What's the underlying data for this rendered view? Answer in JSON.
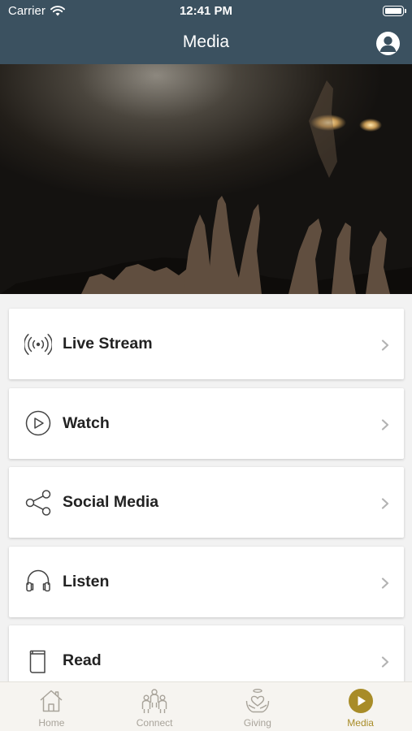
{
  "status_bar": {
    "carrier": "Carrier",
    "time": "12:41 PM"
  },
  "nav": {
    "title": "Media"
  },
  "menu": {
    "items": [
      {
        "label": "Live Stream",
        "icon": "broadcast-icon"
      },
      {
        "label": "Watch",
        "icon": "play-circle-icon"
      },
      {
        "label": "Social Media",
        "icon": "share-icon"
      },
      {
        "label": "Listen",
        "icon": "headphones-icon"
      },
      {
        "label": "Read",
        "icon": "book-icon"
      }
    ]
  },
  "tab_bar": {
    "tabs": [
      {
        "label": "Home",
        "icon": "home-icon",
        "active": false
      },
      {
        "label": "Connect",
        "icon": "people-icon",
        "active": false
      },
      {
        "label": "Giving",
        "icon": "giving-heart-icon",
        "active": false
      },
      {
        "label": "Media",
        "icon": "media-play-icon",
        "active": true
      }
    ]
  },
  "colors": {
    "header": "#3b5160",
    "accent": "#a88c28",
    "tab_inactive": "#a8a39a"
  }
}
